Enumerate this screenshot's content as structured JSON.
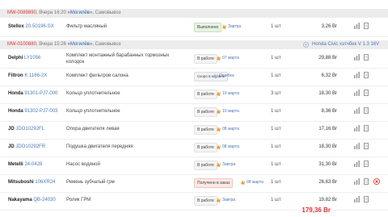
{
  "orders": [
    {
      "number": "MW-0089890,",
      "date": "Вчера 16:20",
      "city": "«Могилёв»,",
      "method": "Самовывоз",
      "car": "",
      "items": [
        {
          "brand": "Stellox",
          "sku": "20-50196-SX",
          "desc": "Фильтр масляный",
          "status": "Выполнено",
          "status_type": "done",
          "delivery": "Завтра",
          "qty": "1 шт",
          "price": "3,26 Br",
          "icons": [
            "bars",
            "doc"
          ]
        }
      ]
    },
    {
      "number": "MW-0100880,",
      "date": "Вчера 15:26",
      "city": "«Могилёв»,",
      "method": "Самовывоз",
      "car": "Honda Civic хэтчбек V 1.3 16V",
      "items": [
        {
          "brand": "Delphi",
          "sku": "LY1056",
          "desc": "Комплект монтажный барабанных тормозных колодок",
          "status": "В работе",
          "status_type": "work",
          "delivery": "07 марта",
          "qty": "1 шт",
          "price": "29,88 Br",
          "icons": [
            "bars",
            "doc"
          ]
        },
        {
          "brand": "Filtron",
          "sku": "K 1166-2X",
          "desc": "Комплект фильтров салона",
          "status": "Скоро в корзине",
          "status_type": "cart",
          "delivery": "Ошибка",
          "qty": "1 шт",
          "price": "6,32 Br",
          "icons": [
            "bars",
            "doc"
          ]
        },
        {
          "brand": "Honda",
          "sku": "91301-PJ7-000",
          "desc": "Кольцо уплотнительное",
          "status": "В работе",
          "status_type": "work",
          "delivery": "10 марта",
          "qty": "3 шт",
          "price": "18,30 Br",
          "icons": [
            "bars",
            "doc"
          ]
        },
        {
          "brand": "Honda",
          "sku": "91302-PJ7-003",
          "desc": "Кольцо уплотнительное",
          "status": "В работе",
          "status_type": "work",
          "delivery": "10 марта",
          "qty": "1 шт",
          "price": "8,36 Br",
          "icons": [
            "bars",
            "doc"
          ]
        },
        {
          "brand": "JD",
          "sku": "JDO10292FL",
          "desc": "Опора двигателя левая",
          "status": "В работе",
          "status_type": "work",
          "delivery": "08 марта",
          "qty": "1 шт",
          "price": "17,16 Br",
          "icons": [
            "bars",
            "doc"
          ]
        },
        {
          "brand": "JD",
          "sku": "JDO10292FR",
          "desc": "Подушка двигателя передняя",
          "status": "В работе",
          "status_type": "work",
          "delivery": "08 марта",
          "qty": "1 шт",
          "price": "18,30 Br",
          "icons": [
            "bars",
            "doc"
          ]
        },
        {
          "brand": "Metelli",
          "sku": "24-0428",
          "desc": "Насос водяной",
          "status": "В работе",
          "status_type": "work",
          "delivery": "Завтра",
          "qty": "1 шт",
          "price": "31,30 Br",
          "icons": [
            "bars",
            "doc"
          ]
        },
        {
          "brand": "Mitsuboshi",
          "sku": "106XR24",
          "desc": "Ремень зубчатый грм",
          "status": "Получено в заказ",
          "status_type": "recv",
          "delivery": "08 марта",
          "qty": "1 шт",
          "price": "26,63 Br",
          "icons": [
            "bars",
            "doc",
            "x"
          ]
        },
        {
          "brand": "Nakayama",
          "sku": "QB-24030",
          "desc": "Ролик ГРМ",
          "status": "В работе",
          "status_type": "work",
          "delivery": "Завтра",
          "qty": "1 шт",
          "price": "19,82 Br",
          "icons": [
            "bars",
            "doc"
          ]
        }
      ]
    }
  ],
  "total": "179,36 Br",
  "colors": {
    "accent": "#d33333",
    "link": "#4a78b8",
    "done": "#e7f2e4",
    "recv": "#fde8e4"
  }
}
